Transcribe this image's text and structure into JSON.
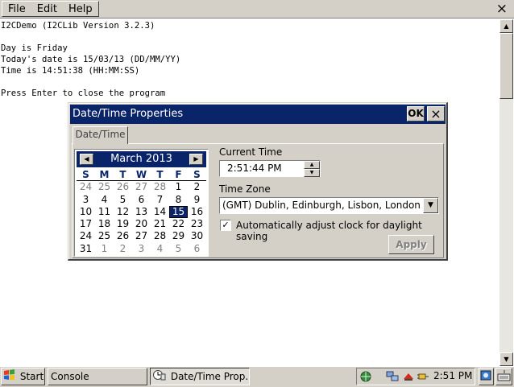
{
  "menu": {
    "items": [
      "File",
      "Edit",
      "Help"
    ],
    "close_glyph": "×"
  },
  "console": {
    "lines": [
      "I2CDemo (I2CLib Version 3.2.3)",
      "",
      "Day is Friday",
      "Today's date is 15/03/13 (DD/MM/YY)",
      "Time is 14:51:38 (HH:MM:SS)",
      "",
      "Press Enter to close the program"
    ]
  },
  "dialog": {
    "title": "Date/Time Properties",
    "ok_label": "OK",
    "close_glyph": "×",
    "tab_label": "Date/Time",
    "calendar": {
      "month_label": "March 2013",
      "weekdays": [
        "S",
        "M",
        "T",
        "W",
        "T",
        "F",
        "S"
      ],
      "selected_day": 15,
      "weeks": [
        [
          [
            "24",
            "other"
          ],
          [
            "25",
            "other"
          ],
          [
            "26",
            "other"
          ],
          [
            "27",
            "other"
          ],
          [
            "28",
            "other"
          ],
          [
            "1",
            ""
          ],
          [
            "2",
            ""
          ]
        ],
        [
          [
            "3",
            ""
          ],
          [
            "4",
            ""
          ],
          [
            "5",
            ""
          ],
          [
            "6",
            ""
          ],
          [
            "7",
            ""
          ],
          [
            "8",
            ""
          ],
          [
            "9",
            ""
          ]
        ],
        [
          [
            "10",
            ""
          ],
          [
            "11",
            ""
          ],
          [
            "12",
            ""
          ],
          [
            "13",
            ""
          ],
          [
            "14",
            ""
          ],
          [
            "15",
            "sel"
          ],
          [
            "16",
            ""
          ]
        ],
        [
          [
            "17",
            ""
          ],
          [
            "18",
            ""
          ],
          [
            "19",
            ""
          ],
          [
            "20",
            ""
          ],
          [
            "21",
            ""
          ],
          [
            "22",
            ""
          ],
          [
            "23",
            ""
          ]
        ],
        [
          [
            "24",
            ""
          ],
          [
            "25",
            ""
          ],
          [
            "26",
            ""
          ],
          [
            "27",
            ""
          ],
          [
            "28",
            ""
          ],
          [
            "29",
            ""
          ],
          [
            "30",
            ""
          ]
        ],
        [
          [
            "31",
            ""
          ],
          [
            "1",
            "other"
          ],
          [
            "2",
            "other"
          ],
          [
            "3",
            "other"
          ],
          [
            "4",
            "other"
          ],
          [
            "5",
            "other"
          ],
          [
            "6",
            "other"
          ]
        ]
      ]
    },
    "current_time_label": "Current Time",
    "current_time_value": "2:51:44 PM",
    "time_zone_label": "Time Zone",
    "time_zone_value": "(GMT) Dublin, Edinburgh, Lisbon, London",
    "dst_checked": true,
    "dst_label": "Automatically adjust clock for daylight saving",
    "apply_label": "Apply"
  },
  "taskbar": {
    "start_label": "Start",
    "tasks": [
      {
        "label": "Console",
        "pressed": false
      },
      {
        "label": "Date/Time Prop...",
        "pressed": true
      }
    ],
    "clock": "2:51 PM"
  },
  "colors": {
    "titlebar": "#0a246a",
    "face": "#d4d0c8"
  }
}
